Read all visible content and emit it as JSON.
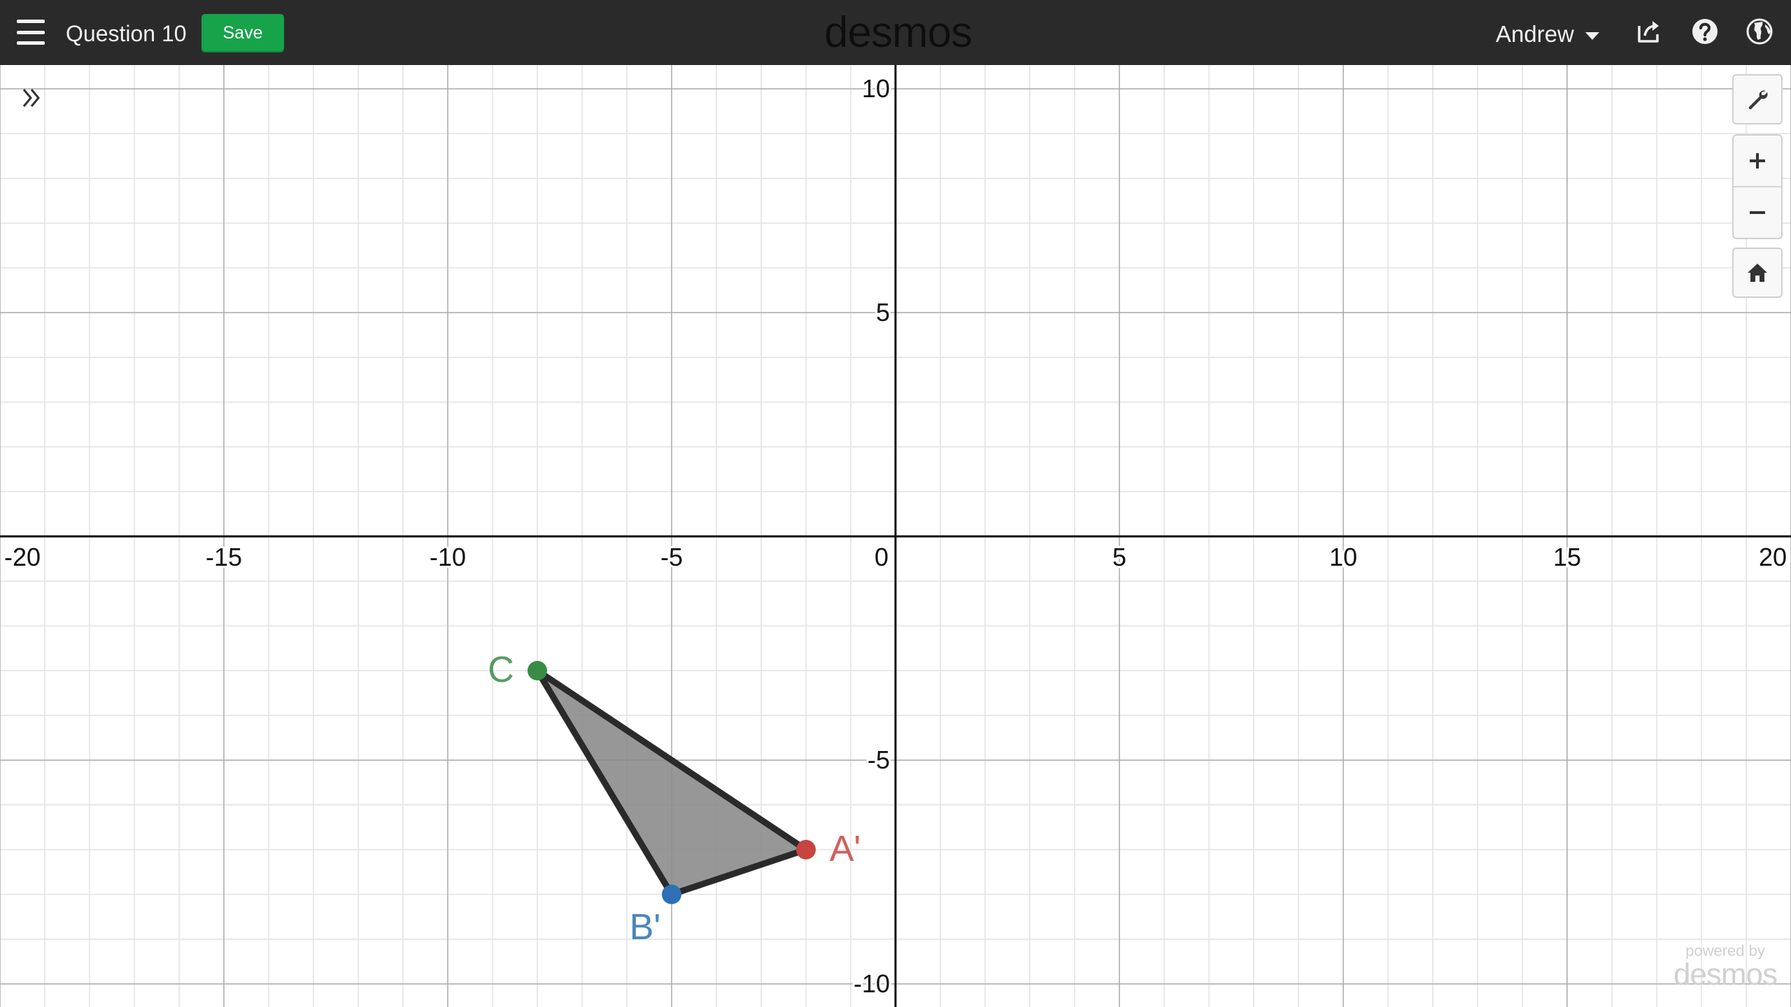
{
  "header": {
    "title": "Question 10",
    "save_label": "Save",
    "logo": "desmos",
    "user": "Andrew"
  },
  "icons": {
    "menu": "hamburger-menu-icon",
    "share": "share-icon",
    "help": "help-icon",
    "language": "globe-icon",
    "expand": "double-chevron-right-icon",
    "settings": "wrench-icon",
    "zoom_in": "plus-icon",
    "zoom_out": "minus-icon",
    "home": "home-icon"
  },
  "footer": {
    "powered_by": "powered by",
    "brand": "desmos"
  },
  "colors": {
    "header_bg": "#2a2a2a",
    "save_green": "#17a34a",
    "point_a": "#c74440",
    "point_b": "#2d70b3",
    "point_c": "#388c46",
    "polygon_fill": "#8c8c8c",
    "polygon_stroke": "#2a2a2a"
  },
  "chart_data": {
    "type": "scatter",
    "xlim": [
      -20,
      20
    ],
    "ylim": [
      -10.5,
      10.5
    ],
    "grid": true,
    "x_ticks": [
      "-20",
      "-15",
      "-10",
      "-5",
      "0",
      "5",
      "10",
      "15",
      "20"
    ],
    "y_ticks": [
      "10",
      "5",
      "-5",
      "-10"
    ],
    "points": [
      {
        "label": "C",
        "x": -8,
        "y": -3,
        "color": "#388c46"
      },
      {
        "label": "A'",
        "x": -2,
        "y": -7,
        "color": "#c74440"
      },
      {
        "label": "B'",
        "x": -5,
        "y": -8,
        "color": "#2d70b3"
      }
    ],
    "polygon": [
      [
        -8,
        -3
      ],
      [
        -2,
        -7
      ],
      [
        -5,
        -8
      ]
    ]
  }
}
